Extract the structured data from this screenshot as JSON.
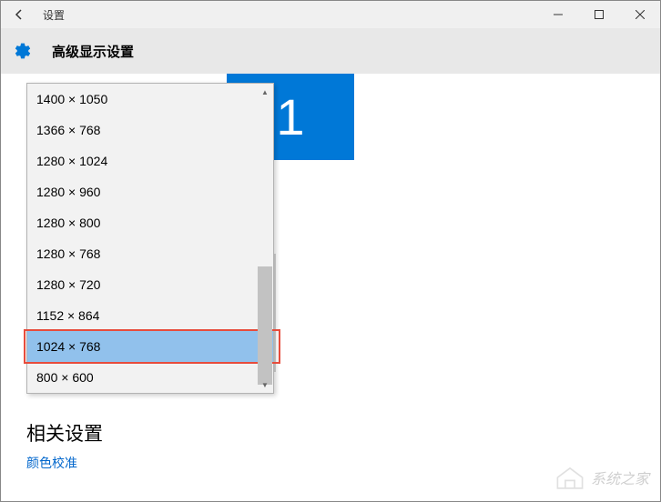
{
  "titlebar": {
    "title": "设置"
  },
  "header": {
    "title": "高级显示设置"
  },
  "monitor": {
    "number": "1"
  },
  "resolutions": {
    "items": [
      {
        "label": "1400 × 1050",
        "selected": false
      },
      {
        "label": "1366 × 768",
        "selected": false
      },
      {
        "label": "1280 × 1024",
        "selected": false
      },
      {
        "label": "1280 × 960",
        "selected": false
      },
      {
        "label": "1280 × 800",
        "selected": false
      },
      {
        "label": "1280 × 768",
        "selected": false
      },
      {
        "label": "1280 × 720",
        "selected": false
      },
      {
        "label": "1152 × 864",
        "selected": false
      },
      {
        "label": "1024 × 768",
        "selected": true
      },
      {
        "label": "800 × 600",
        "selected": false
      }
    ]
  },
  "related": {
    "title": "相关设置",
    "color_link": "颜色校准"
  },
  "watermark": {
    "text": "系统之家"
  }
}
